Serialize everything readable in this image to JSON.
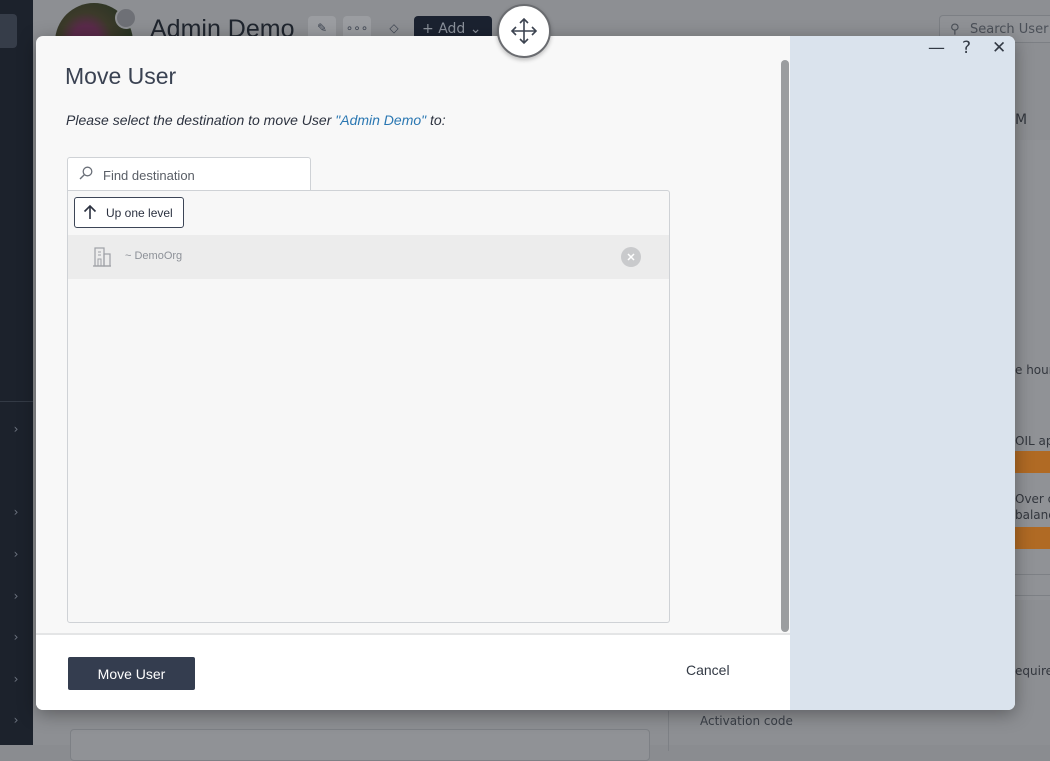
{
  "background": {
    "user_name": "Admin Demo",
    "add_label": "Add",
    "search_placeholder": "Search User",
    "right_fragments": [
      "M",
      "e hour",
      "OIL ap",
      "Over c",
      "balanc",
      "equire"
    ],
    "activation_code_label": "Activation code"
  },
  "window_controls": {
    "minimize": "—",
    "help": "?",
    "close": "✕"
  },
  "modal": {
    "title": "Move User",
    "instruction_prefix": "Please select the destination to move User ",
    "instruction_user": "\"Admin Demo\"",
    "instruction_suffix": " to:",
    "find_placeholder": "Find destination",
    "find_value": "",
    "up_one_level_label": "Up one level",
    "destinations": [
      {
        "name": "~ DemoOrg",
        "icon": "building-icon"
      }
    ],
    "primary_button_label": "Move User",
    "cancel_label": "Cancel"
  },
  "colors": {
    "primary_button": "#343d4f",
    "link": "#2a77b2",
    "side_panel": "#dae3ed"
  }
}
